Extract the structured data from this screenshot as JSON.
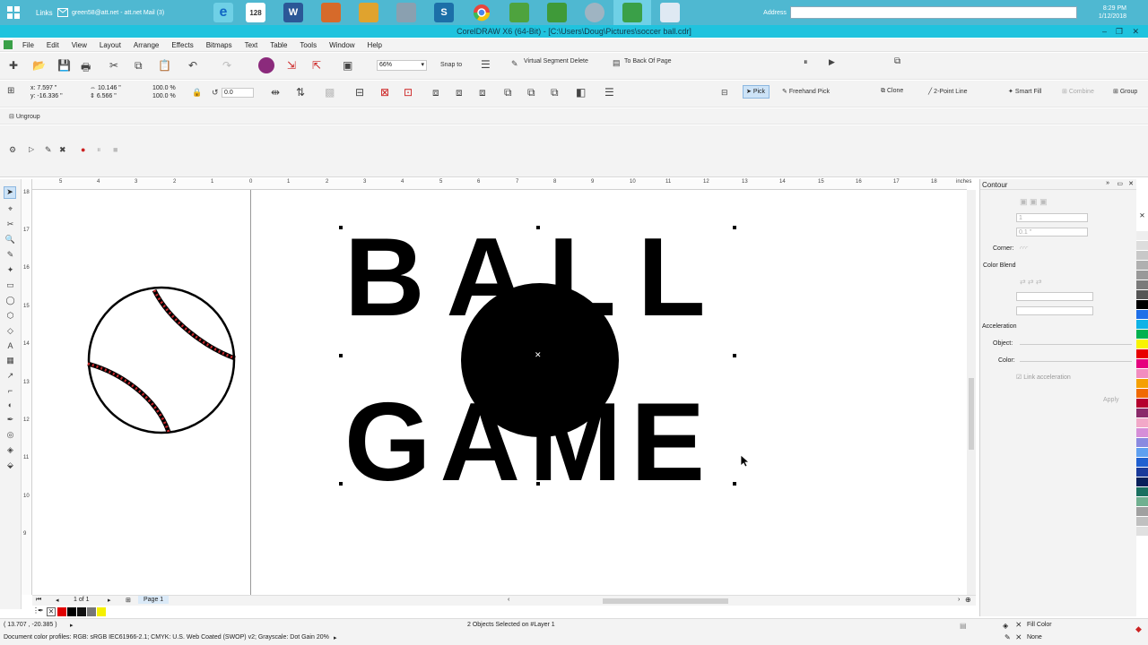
{
  "taskbar": {
    "links_label": "Links",
    "mail_label": "green58@att.net - att.net Mail (3)",
    "address_label": "Address",
    "clock_time": "8:29 PM",
    "clock_date": "1/12/2018"
  },
  "window": {
    "title": "CorelDRAW X6 (64-Bit) - [C:\\Users\\Doug\\Pictures\\soccer ball.cdr]"
  },
  "menu": [
    "File",
    "Edit",
    "View",
    "Layout",
    "Arrange",
    "Effects",
    "Bitmaps",
    "Text",
    "Table",
    "Tools",
    "Window",
    "Help"
  ],
  "standard_toolbar": {
    "zoom_value": "66%",
    "snap_label": "Snap to",
    "virtual_segment_delete": "Virtual Segment Delete",
    "to_back_of_page": "To Back Of Page"
  },
  "property_bar": {
    "x": "7.597 \"",
    "y": "-16.336 \"",
    "width": "10.146 \"",
    "height": "6.566 \"",
    "scale_x": "100.0",
    "scale_y": "100.0",
    "pct": "%",
    "rotation": "0.0",
    "pick_label": "Pick",
    "freehand_pick_label": "Freehand Pick",
    "clone_label": "Clone",
    "two_point_line_label": "2-Point Line",
    "smart_fill_label": "Smart Fill",
    "combine_label": "Combine",
    "group_label": "Group",
    "ungroup_label": "Ungroup"
  },
  "ruler": {
    "unit": "inches",
    "ticks": [
      "5",
      "4",
      "3",
      "2",
      "1",
      "0",
      "1",
      "2",
      "3",
      "4",
      "5",
      "6",
      "7",
      "8",
      "9",
      "10",
      "11",
      "12",
      "13",
      "14",
      "15",
      "16",
      "17",
      "18"
    ],
    "vticks": [
      "18",
      "17",
      "16",
      "15",
      "14",
      "13",
      "12",
      "11",
      "10",
      "9"
    ]
  },
  "canvas": {
    "word_top": "BALL",
    "word_bottom": "GAME"
  },
  "page_nav": {
    "counter": "1 of 1",
    "page_tab": "Page 1"
  },
  "docker": {
    "title": "Contour",
    "steps_value": "1",
    "offset_value": "0.1 \"",
    "corner_label": "Corner:",
    "color_blend_label": "Color Blend",
    "acceleration_label": "Acceleration",
    "object_label": "Object:",
    "color_label": "Color:",
    "link_acceleration_label": "Link acceleration",
    "apply_label": "Apply"
  },
  "status": {
    "coords": "( 13.707 , -20.385 )",
    "selection": "2 Objects Selected on #Layer 1",
    "profiles": "Document color profiles: RGB: sRGB IEC61966-2.1; CMYK: U.S. Web Coated (SWOP) v2; Grayscale: Dot Gain 20%",
    "fill_label": "Fill Color",
    "outline_label": "None"
  },
  "colors": {
    "taskbar": "#4fb8d1",
    "titlebar": "#1fc3de",
    "stitch_red": "#c8282c"
  }
}
